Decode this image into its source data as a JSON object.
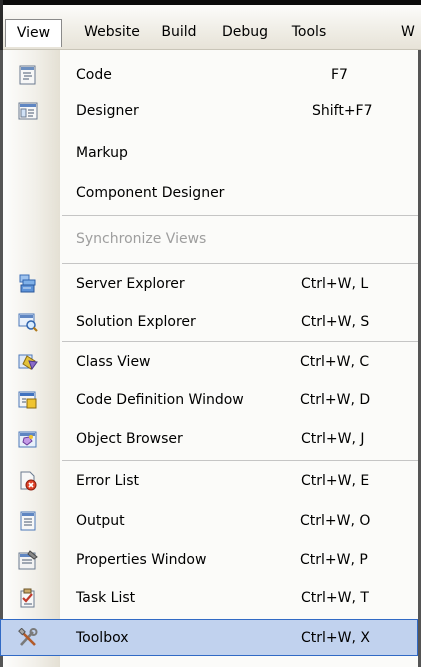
{
  "menubar": {
    "items": [
      {
        "label": "View"
      },
      {
        "label": "Website"
      },
      {
        "label": "Build"
      },
      {
        "label": "Debug"
      },
      {
        "label": "Tools"
      },
      {
        "label": "W"
      }
    ],
    "active_index": 0
  },
  "dropdown": {
    "items": [
      {
        "label": "Code",
        "shortcut": "F7",
        "icon": "code-view-icon",
        "enabled": true
      },
      {
        "label": "Designer",
        "shortcut": "Shift+F7",
        "icon": "designer-icon",
        "enabled": true
      },
      {
        "label": "Markup",
        "shortcut": "",
        "icon": "",
        "enabled": true
      },
      {
        "label": "Component Designer",
        "shortcut": "",
        "icon": "",
        "enabled": true
      },
      {
        "label": "Synchronize Views",
        "shortcut": "",
        "icon": "",
        "enabled": false
      },
      {
        "label": "Server Explorer",
        "shortcut": "Ctrl+W, L",
        "icon": "server-explorer-icon",
        "enabled": true
      },
      {
        "label": "Solution Explorer",
        "shortcut": "Ctrl+W, S",
        "icon": "solution-explorer-icon",
        "enabled": true
      },
      {
        "label": "Class View",
        "shortcut": "Ctrl+W, C",
        "icon": "class-view-icon",
        "enabled": true
      },
      {
        "label": "Code Definition Window",
        "shortcut": "Ctrl+W, D",
        "icon": "code-definition-window-icon",
        "enabled": true
      },
      {
        "label": "Object Browser",
        "shortcut": "Ctrl+W, J",
        "icon": "object-browser-icon",
        "enabled": true
      },
      {
        "label": "Error List",
        "shortcut": "Ctrl+W, E",
        "icon": "error-list-icon",
        "enabled": true
      },
      {
        "label": "Output",
        "shortcut": "Ctrl+W, O",
        "icon": "output-icon",
        "enabled": true
      },
      {
        "label": "Properties Window",
        "shortcut": "Ctrl+W, P",
        "icon": "properties-window-icon",
        "enabled": true
      },
      {
        "label": "Task List",
        "shortcut": "Ctrl+W, T",
        "icon": "task-list-icon",
        "enabled": true
      },
      {
        "label": "Toolbox",
        "shortcut": "Ctrl+W, X",
        "icon": "toolbox-icon",
        "enabled": true
      }
    ],
    "highlighted_index": 14
  },
  "colors": {
    "highlight_fill": "#c1d2ee",
    "highlight_border": "#316ac5",
    "disabled_text": "#9e9e9e"
  }
}
